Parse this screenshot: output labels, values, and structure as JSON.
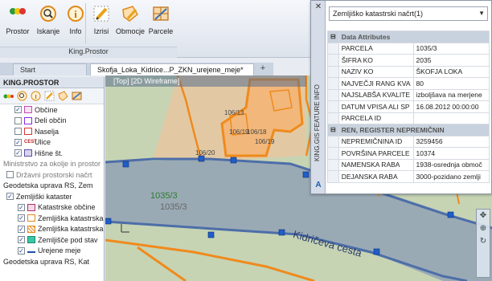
{
  "ribbon": {
    "buttons": [
      {
        "label": "Prostor",
        "icon": "traffic-light-icon"
      },
      {
        "label": "Iskanje",
        "icon": "magnifier-icon"
      },
      {
        "label": "Info",
        "icon": "info-icon"
      },
      {
        "label": "Izrisi",
        "icon": "pencil-icon"
      },
      {
        "label": "Obmocje",
        "icon": "area-pencil-icon"
      },
      {
        "label": "Parcele",
        "icon": "parcel-icon"
      }
    ],
    "group_label": "King.Prostor"
  },
  "tabs": [
    {
      "label": "Start"
    },
    {
      "label": "Skofja_Loka_Kidrice...P_ZKN_urejene_meje*"
    }
  ],
  "panel": {
    "title": "KING.PROSTOR",
    "rows": [
      {
        "label": "Občine"
      },
      {
        "label": "Deli občin"
      },
      {
        "label": "Naselja"
      },
      {
        "label": "Ulice"
      },
      {
        "label": "Hišne št."
      },
      {
        "label": "Ministrstvo za okolje in prostor"
      },
      {
        "label": "Državni prostorski načrt"
      },
      {
        "label": "Geodetska uprava RS, Zem"
      },
      {
        "label": "Zemljiški kataster"
      },
      {
        "label": "Katastrske občine"
      },
      {
        "label": "Zemljiška katastrska"
      },
      {
        "label": "Zemljiška katastrska"
      },
      {
        "label": "Zemljišče pod stav"
      },
      {
        "label": "Urejene meje"
      },
      {
        "label": "Geodetska uprava RS, Kat"
      }
    ]
  },
  "map": {
    "header": "[Top] [2D Wireframe]",
    "labels": {
      "parcel_a": "1035/3",
      "parcel_b": "1035/3",
      "street": "Kidričeva cesta",
      "p1": "106/13",
      "p2": "106/18",
      "p3": "106/19",
      "p4": "106/19",
      "p5": "106/20"
    }
  },
  "feature_info": {
    "side_title": "KING.GIS FEATURE INFO",
    "selected": "Zemljiško katastrski načrt(1)",
    "sections": [
      {
        "title": "Data Attributes",
        "rows": [
          {
            "k": "PARCELA",
            "v": "1035/3"
          },
          {
            "k": "ŠIFRA KO",
            "v": "2035"
          },
          {
            "k": "NAZIV KO",
            "v": "ŠKOFJA LOKA"
          },
          {
            "k": "NAJVEČJI RANG KVA",
            "v": "80"
          },
          {
            "k": "NAJSLABŠA KVALITE",
            "v": "izboljšava na merjene"
          },
          {
            "k": "DATUM VPISA ALI SP",
            "v": "16.08.2012 00:00:00"
          },
          {
            "k": "PARCELA ID",
            "v": ""
          }
        ]
      },
      {
        "title": "REN, REGISTER NEPREMIČNIN",
        "rows": [
          {
            "k": "NEPREMIČNINA ID",
            "v": "3259456"
          },
          {
            "k": "POVRŠINA PARCELE",
            "v": "10374"
          },
          {
            "k": "NAMENSKA RABA",
            "v": "1938-osrednja območ"
          },
          {
            "k": "DEJANSKA RABA",
            "v": "3000-pozidano zemlji"
          }
        ]
      }
    ]
  },
  "colors": {
    "accent_orange": "#f08a1c",
    "road_blue": "#4d6ea8",
    "road_fill": "#9aaab5"
  }
}
